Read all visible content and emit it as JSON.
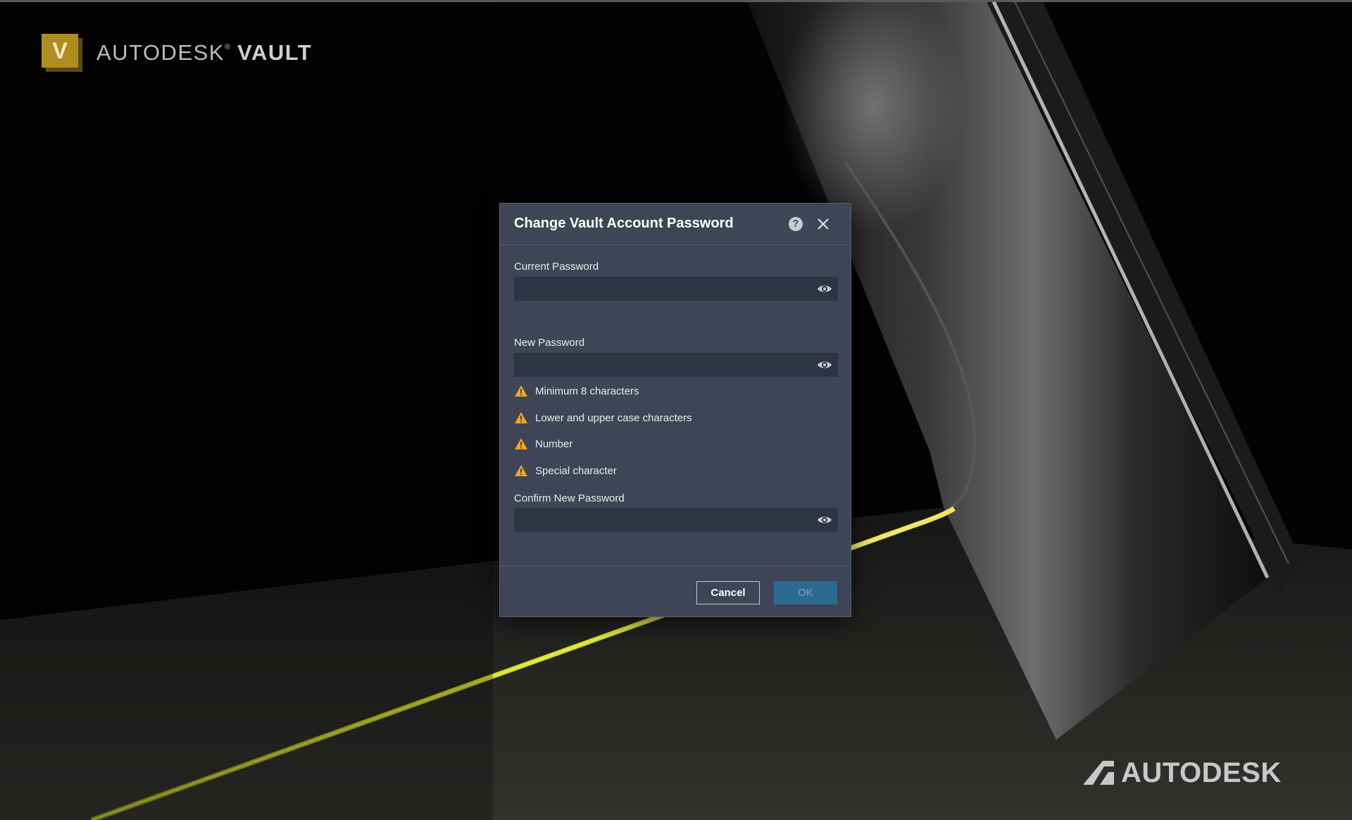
{
  "brand": {
    "logo_letter": "V",
    "company": "AUTODESK",
    "registered": "®",
    "product": "VAULT"
  },
  "footer": {
    "wordmark": "AUTODESK"
  },
  "dialog": {
    "title": "Change Vault Account Password",
    "help_symbol": "?",
    "current_password": {
      "label": "Current Password",
      "value": "",
      "placeholder": ""
    },
    "new_password": {
      "label": "New Password",
      "value": "",
      "placeholder": ""
    },
    "requirements": [
      {
        "text": "Minimum 8 characters",
        "status": "warning"
      },
      {
        "text": "Lower and upper case characters",
        "status": "warning"
      },
      {
        "text": "Number",
        "status": "warning"
      },
      {
        "text": "Special character",
        "status": "warning"
      }
    ],
    "confirm_password": {
      "label": "Confirm New Password",
      "value": "",
      "placeholder": ""
    },
    "buttons": {
      "cancel": "Cancel",
      "ok": "OK"
    }
  },
  "icons": {
    "help": "help-icon",
    "close": "close-icon",
    "show_password": "eye-icon",
    "requirement": "warning-icon"
  },
  "colors": {
    "dialog_bg": "#3d4556",
    "field_bg": "#2e3443",
    "warning": "#f5a623",
    "ok_button": "#2d6a92",
    "brand_gold": "#b08d1f",
    "accent_yellow": "#d7e11a"
  }
}
